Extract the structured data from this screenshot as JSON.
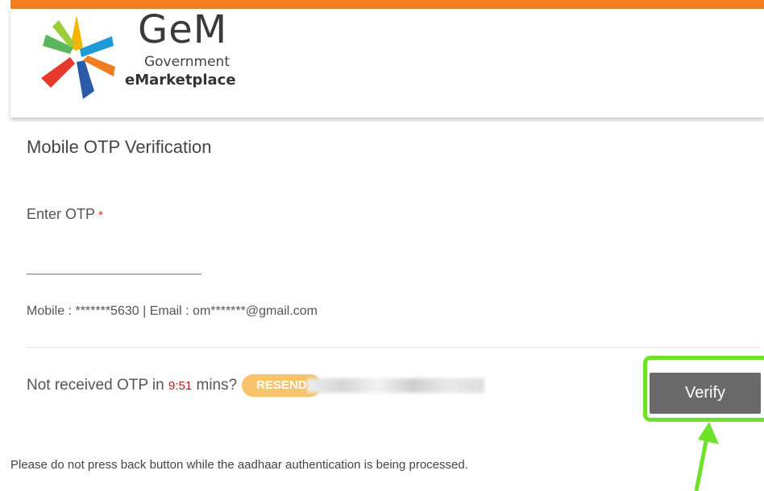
{
  "brand": {
    "name": "GeM",
    "line1": "Government",
    "line2": "eMarketplace",
    "accent_color": "#f47e20"
  },
  "form": {
    "title": "Mobile OTP Verification",
    "otp_label": "Enter OTP",
    "required_mark": "*",
    "otp_value": "",
    "contact_info": "Mobile : *******5630 | Email : om*******@gmail.com",
    "resend_prefix": "Not received OTP in ",
    "timer": "9:51",
    "resend_suffix": " mins?",
    "resend_label": "RESEND",
    "verify_label": "Verify"
  },
  "notice": "Please do not press back button while the aadhaar authentication is being processed.",
  "annotation": {
    "highlight_color": "#6ee12a"
  }
}
